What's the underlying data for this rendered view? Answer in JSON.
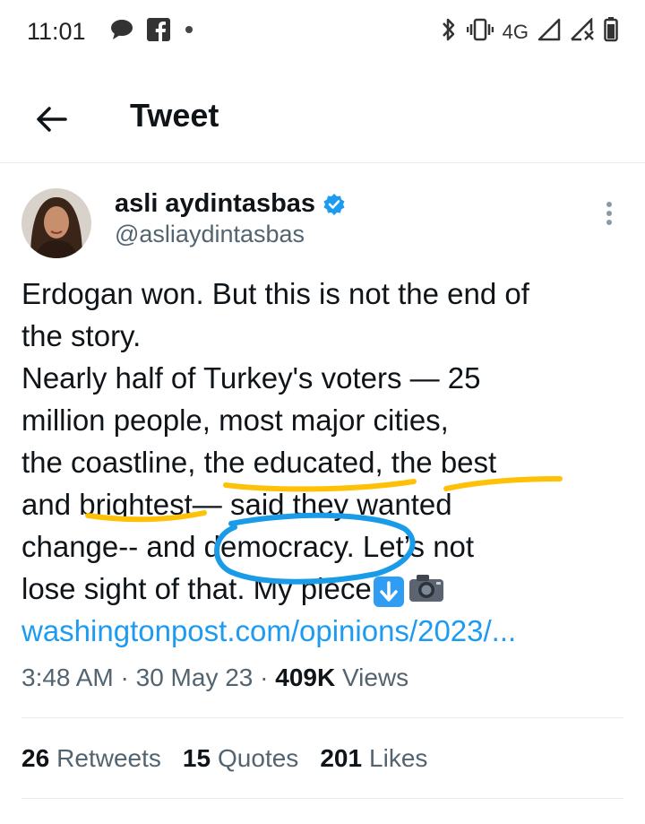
{
  "status_bar": {
    "time": "11:01",
    "network": "4G",
    "left_icons": [
      "chat-bubble-icon",
      "facebook-icon",
      "dot-icon"
    ],
    "right_icons": [
      "bluetooth-icon",
      "vibrate-icon",
      "signal-icon",
      "signal-no-sim-icon",
      "battery-icon"
    ]
  },
  "header": {
    "title": "Tweet",
    "back_icon": "back-arrow-icon"
  },
  "tweet": {
    "author_name": "asli aydintasbas",
    "author_handle": "@asliaydintasbas",
    "verified_color": "#1d9bf0",
    "lines": [
      "Erdogan won. But this is not the end of",
      "the story.",
      "Nearly half of Turkey's voters — 25",
      "million people, most major cities,",
      "the coastline, the educated, the best",
      "and brightest— said they wanted",
      "change-- and democracy. Let’s not",
      "lose sight of that. My piece"
    ],
    "link": "washingtonpost.com/opinions/2023/...",
    "time": "3:48 AM",
    "date": "30 May 23",
    "views_count": "409K",
    "views_label": "Views"
  },
  "stats": {
    "retweets_count": "26",
    "retweets_label": "Retweets",
    "quotes_count": "15",
    "quotes_label": "Quotes",
    "likes_count": "201",
    "likes_label": "Likes"
  },
  "colors": {
    "underline_yellow": "#ffc107",
    "circle_blue": "#1a9be8",
    "link": "#1d9bf0",
    "secondary_text": "#536471"
  }
}
